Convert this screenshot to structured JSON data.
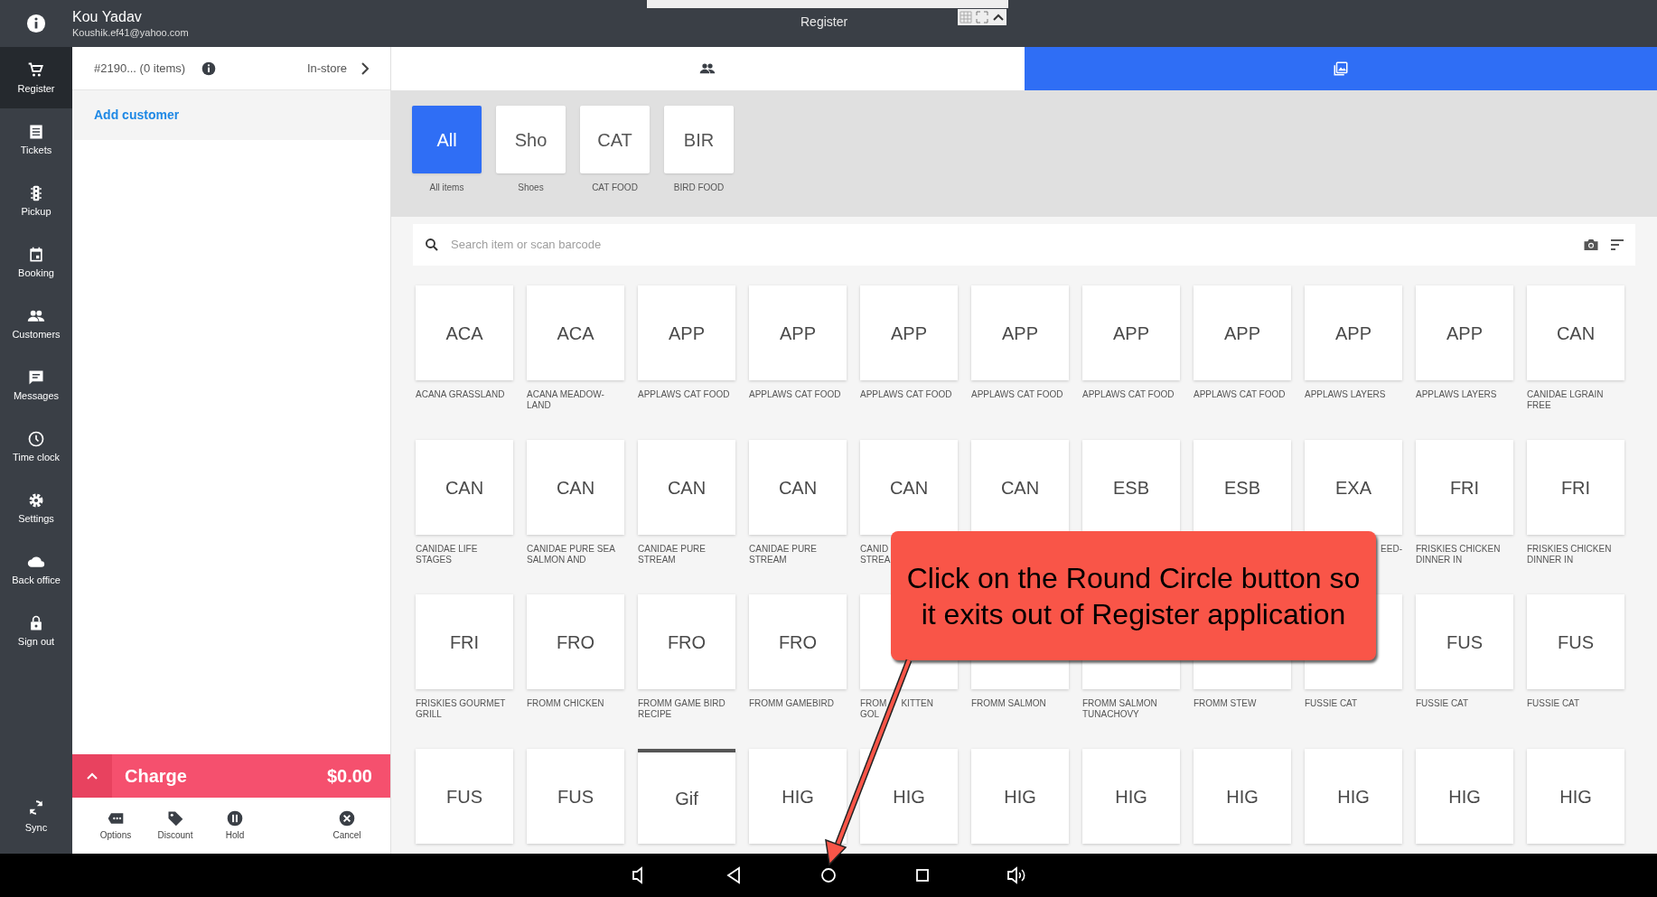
{
  "header": {
    "user_name": "Kou Yadav",
    "user_email": "Koushik.ef41@yahoo.com",
    "title": "Register"
  },
  "sidebar": {
    "items": [
      {
        "label": "Register",
        "selected": true
      },
      {
        "label": "Tickets",
        "selected": false
      },
      {
        "label": "Pickup",
        "selected": false
      },
      {
        "label": "Booking",
        "selected": false
      },
      {
        "label": "Customers",
        "selected": false
      },
      {
        "label": "Messages",
        "selected": false
      },
      {
        "label": "Time clock",
        "selected": false
      },
      {
        "label": "Settings",
        "selected": false
      },
      {
        "label": "Back office",
        "selected": false
      },
      {
        "label": "Sign out",
        "selected": false
      }
    ],
    "footer_item": {
      "label": "Sync"
    }
  },
  "ticket": {
    "number": "#2190... (0 items)",
    "mode": "In-store",
    "add_customer": "Add customer"
  },
  "charge": {
    "label": "Charge",
    "amount": "$0.00"
  },
  "actions": [
    {
      "label": "Options"
    },
    {
      "label": "Discount"
    },
    {
      "label": "Hold"
    },
    {
      "label": "Cancel"
    }
  ],
  "view_tabs": [
    {
      "selected": false
    },
    {
      "selected": true
    }
  ],
  "categories": [
    {
      "abbr": "All",
      "label": "All items",
      "selected": true
    },
    {
      "abbr": "Sho",
      "label": "Shoes",
      "selected": false
    },
    {
      "abbr": "CAT",
      "label": "CAT FOOD",
      "selected": false
    },
    {
      "abbr": "BIR",
      "label": "BIRD FOOD",
      "selected": false
    }
  ],
  "search": {
    "placeholder": "Search item or scan barcode"
  },
  "item_rows": [
    [
      {
        "abbr": "ACA",
        "label": "ACANA GRASSLAND",
        "selected": false
      },
      {
        "abbr": "ACA",
        "label": "ACANA MEADOW-LAND",
        "selected": false
      },
      {
        "abbr": "APP",
        "label": "APPLAWS CAT FOOD",
        "selected": false
      },
      {
        "abbr": "APP",
        "label": "APPLAWS CAT FOOD",
        "selected": false
      },
      {
        "abbr": "APP",
        "label": "APPLAWS CAT FOOD",
        "selected": false
      },
      {
        "abbr": "APP",
        "label": "APPLAWS CAT FOOD",
        "selected": false
      },
      {
        "abbr": "APP",
        "label": "APPLAWS CAT FOOD",
        "selected": false
      },
      {
        "abbr": "APP",
        "label": "APPLAWS CAT FOOD",
        "selected": false
      },
      {
        "abbr": "APP",
        "label": "APPLAWS LAYERS",
        "selected": false
      },
      {
        "abbr": "APP",
        "label": "APPLAWS LAYERS",
        "selected": false
      },
      {
        "abbr": "CAN",
        "label": "CANIDAE LGRAIN FREE",
        "selected": false
      }
    ],
    [
      {
        "abbr": "CAN",
        "label": "CANIDAE LIFE STAGES",
        "selected": false
      },
      {
        "abbr": "CAN",
        "label": "CANIDAE PURE SEA SALMON AND",
        "selected": false
      },
      {
        "abbr": "CAN",
        "label": "CANIDAE PURE STREAM",
        "selected": false
      },
      {
        "abbr": "CAN",
        "label": "CANIDAE PURE STREAM",
        "selected": false
      },
      {
        "abbr": "CAN",
        "label": "CANID STREA",
        "cut_right": true,
        "selected": false
      },
      {
        "abbr": "CAN",
        "selected": false
      },
      {
        "abbr": "ESB",
        "selected": false
      },
      {
        "abbr": "ESB",
        "selected": false
      },
      {
        "abbr": "EXA",
        "label": "EED-",
        "cut_left": true,
        "selected": false
      },
      {
        "abbr": "FRI",
        "label": "FRISKIES CHICKEN DINNER IN",
        "selected": false
      },
      {
        "abbr": "FRI",
        "label": "FRISKIES CHICKEN DINNER IN",
        "selected": false
      }
    ],
    [
      {
        "abbr": "FRI",
        "label": "FRISKIES GOURMET GRILL",
        "selected": false
      },
      {
        "abbr": "FRO",
        "label": "FROMM CHICKEN",
        "selected": false
      },
      {
        "abbr": "FRO",
        "label": "FROMM GAME BIRD RECIPE",
        "selected": false
      },
      {
        "abbr": "FRO",
        "label": "FROMM GAMEBIRD",
        "selected": false
      },
      {
        "label": "FROM",
        "label_rest": "KITTEN",
        "label_line2": "GOL",
        "selected": false
      },
      {
        "label": "FROMM SALMON"
      },
      {
        "label": "FROMM SALMON TUNACHOVY"
      },
      {
        "label": "FROMM STEW"
      },
      {
        "label": "FUSSIE CAT",
        "selected": false
      },
      {
        "abbr": "FUS",
        "label": "FUSSIE CAT",
        "selected": false
      },
      {
        "abbr": "FUS",
        "label": "FUSSIE CAT",
        "selected": false
      }
    ],
    [
      {
        "abbr": "FUS",
        "selected": false
      },
      {
        "abbr": "FUS",
        "selected": false
      },
      {
        "abbr": "Gif",
        "selected": true
      },
      {
        "abbr": "HIG",
        "selected": false
      },
      {
        "abbr": "HIG",
        "selected": false
      },
      {
        "abbr": "HIG",
        "selected": false
      },
      {
        "abbr": "HIG",
        "selected": false
      },
      {
        "abbr": "HIG",
        "selected": false
      },
      {
        "abbr": "HIG",
        "selected": false
      },
      {
        "abbr": "HIG",
        "selected": false
      },
      {
        "abbr": "HIG",
        "selected": false
      }
    ]
  ],
  "callout": {
    "text": "Click on the Round Circle button so it exits out of Register application"
  }
}
